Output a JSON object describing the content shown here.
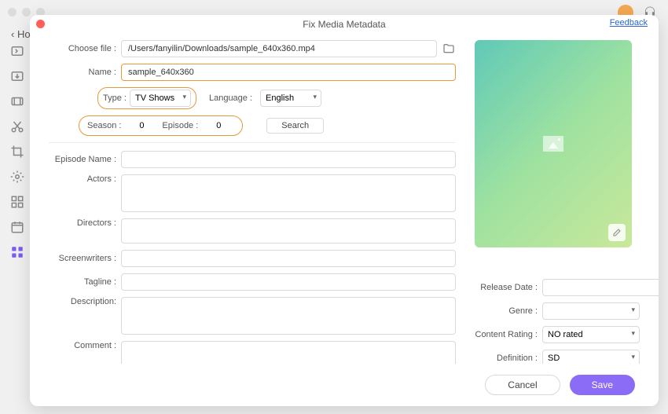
{
  "window": {
    "title": "Fix Media Metadata",
    "feedback": "Feedback",
    "home_back": "‹ Ho"
  },
  "fields": {
    "choose_file": {
      "label": "Choose file :",
      "value": "/Users/fanyilin/Downloads/sample_640x360.mp4"
    },
    "name": {
      "label": "Name :",
      "value": "sample_640x360"
    },
    "type": {
      "label": "Type :",
      "value": "TV Shows"
    },
    "language": {
      "label": "Language :",
      "value": "English"
    },
    "season": {
      "label": "Season :",
      "value": "0"
    },
    "episode": {
      "label": "Episode :",
      "value": "0"
    },
    "search_btn": "Search",
    "episode_name": {
      "label": "Episode Name :"
    },
    "actors": {
      "label": "Actors :"
    },
    "directors": {
      "label": "Directors :"
    },
    "screenwriters": {
      "label": "Screenwriters :"
    },
    "tagline": {
      "label": "Tagline :"
    },
    "description": {
      "label": "Description:"
    },
    "comment": {
      "label": "Comment :"
    },
    "release_date": {
      "label": "Release Date :"
    },
    "genre": {
      "label": "Genre :"
    },
    "content_rating": {
      "label": "Content Rating :",
      "value": "NO rated"
    },
    "definition": {
      "label": "Definition :",
      "value": "SD"
    }
  },
  "footer": {
    "cancel": "Cancel",
    "save": "Save"
  }
}
